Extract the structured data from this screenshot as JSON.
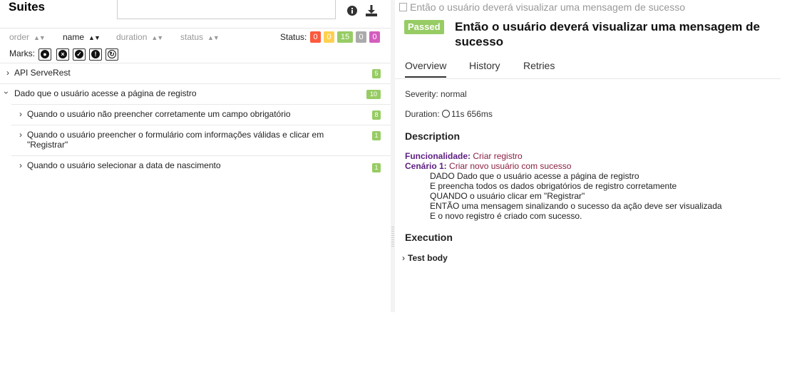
{
  "left": {
    "title": "Suites",
    "sort": {
      "order": "order",
      "name": "name",
      "duration": "duration",
      "status": "status",
      "status_label": "Status:"
    },
    "status_counts": [
      {
        "value": "0",
        "color": "#fd5a3e"
      },
      {
        "value": "0",
        "color": "#ffd050"
      },
      {
        "value": "15",
        "color": "#97cc64"
      },
      {
        "value": "0",
        "color": "#aaaaaa"
      },
      {
        "value": "0",
        "color": "#d35ebe"
      }
    ],
    "marks_label": "Marks:",
    "tree": [
      {
        "label": "API ServeRest",
        "count": "5",
        "expanded": false
      },
      {
        "label": "Dado que o usuário acesse a página de registro",
        "count": "10",
        "expanded": true
      },
      {
        "label": "Quando o usuário não preencher corretamente um campo obrigatório",
        "count": "8"
      },
      {
        "label": "Quando o usuário preencher o formulário com informações válidas e clicar em \"Registrar\"",
        "count": "1"
      },
      {
        "label": "Quando o usuário selecionar a data de nascimento",
        "count": "1"
      }
    ]
  },
  "right": {
    "breadcrumb": "Então o usuário deverá visualizar uma mensagem de sucesso",
    "status": "Passed",
    "title": "Então o usuário deverá visualizar uma mensagem de sucesso",
    "tabs": [
      "Overview",
      "History",
      "Retries"
    ],
    "severity": "Severity: normal",
    "duration_label": "Duration:",
    "duration_value": "11s 656ms",
    "description_heading": "Description",
    "description": {
      "feature_key": "Funcionalidade:",
      "feature_value": "Criar registro",
      "scenario_key": "Cenário 1:",
      "scenario_value": "Criar novo usuário com sucesso",
      "lines": [
        "DADO Dado que o usuário acesse a página de registro",
        "E preencha todos os dados obrigatórios de registro corretamente",
        "QUANDO o usuário clicar em \"Registrar\"",
        "ENTÃO uma mensagem sinalizando o sucesso da ação deve ser visualizada",
        "E o novo registro é criado com sucesso."
      ]
    },
    "execution_heading": "Execution",
    "test_body": "Test body"
  }
}
